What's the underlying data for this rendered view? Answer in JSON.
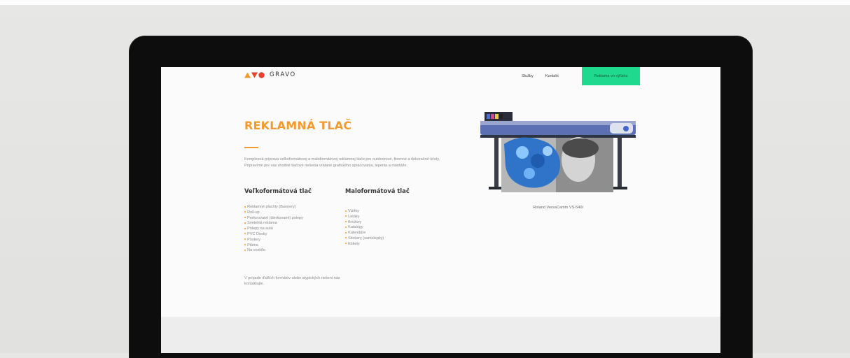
{
  "brand": {
    "name": "GRAVO"
  },
  "nav": {
    "items": [
      "Služby",
      "Kontakt"
    ],
    "cta": "Reklama vo výťahu"
  },
  "hero": {
    "title": "REKLAMNÁ TLAČ",
    "intro": "Komplexná príprava veľkoformátovej a maloformátovej reklamnej tlače pre outdoorové, firemné a dekoračné účely. Pripravíme pre vás vhodné tlačové riešenia vrátane grafického spracovania, lepenia a montáže."
  },
  "large_format": {
    "title": "Veľkoformátová tlač",
    "items": [
      "Reklamné plachty (Bannery)",
      "Roll-up",
      "Perforované (dierkované) polepy",
      "Svetelná reklama",
      "Polepy na autá",
      "PVC Dosky",
      "Postery",
      "Plátna",
      "Na vozidlo"
    ]
  },
  "small_format": {
    "title": "Maloformátová tlač",
    "items": [
      "Vizitky",
      "Letáky",
      "Brožúry",
      "Katalógy",
      "Kalendáre",
      "Stickery (samolepky)",
      "Etikety"
    ]
  },
  "note": "V prípade ďalších formátov alebo atypických riešení nás kontaktujte.",
  "printer": {
    "caption": "Roland VersaCamm VS-540i"
  },
  "colors": {
    "accent": "#f39a2e",
    "cta": "#1fd98e",
    "logo_red": "#e8412c"
  }
}
